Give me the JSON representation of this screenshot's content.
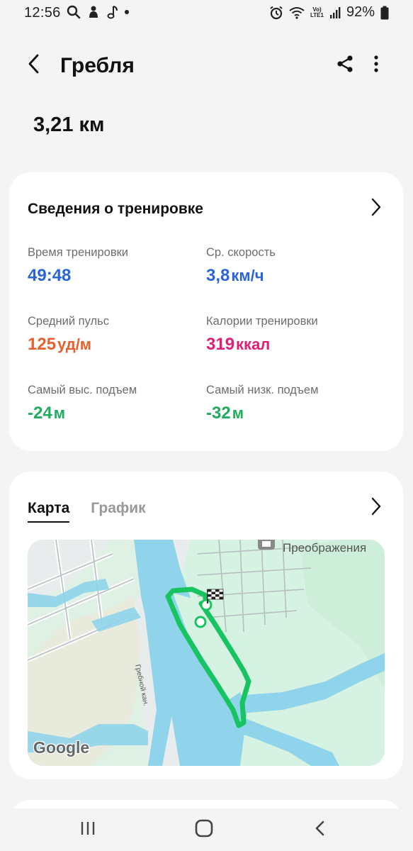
{
  "status_bar": {
    "time": "12:56",
    "battery": "92%",
    "volte_top": "Vo)",
    "volte_bottom": "LTE1"
  },
  "app_bar": {
    "title": "Гребля",
    "back_icon": "arrow-back-icon",
    "share_icon": "share-icon",
    "more_icon": "more-vert-icon"
  },
  "distance": "3,21 км",
  "workout_card": {
    "header": "Сведения о тренировке",
    "stats": [
      {
        "label": "Время тренировки",
        "value": "49:48",
        "unit": "",
        "color": "#2a65d8"
      },
      {
        "label": "Ср. скорость",
        "value": "3,8",
        "unit": "км/ч",
        "color": "#2a65d8"
      },
      {
        "label": "Средний пульс",
        "value": "125",
        "unit": "уд/м",
        "color": "#e8602c"
      },
      {
        "label": "Калории тренировки",
        "value": "319",
        "unit": "ккал",
        "color": "#e01e78"
      },
      {
        "label": "Самый выс. подъем",
        "value": "-24",
        "unit": "м",
        "color": "#1fad5d"
      },
      {
        "label": "Самый низк. подъем",
        "value": "-32",
        "unit": "м",
        "color": "#1fad5d"
      }
    ]
  },
  "map_card": {
    "tabs": [
      {
        "label": "Карта",
        "active": true
      },
      {
        "label": "График",
        "active": false
      }
    ],
    "map_labels": {
      "place": "Преображения",
      "canal": "Гребной кан.",
      "attribution": "Google"
    },
    "colors": {
      "water": "#8fd4ea",
      "park": "#d6f2e2",
      "route": "#17c45f"
    }
  }
}
